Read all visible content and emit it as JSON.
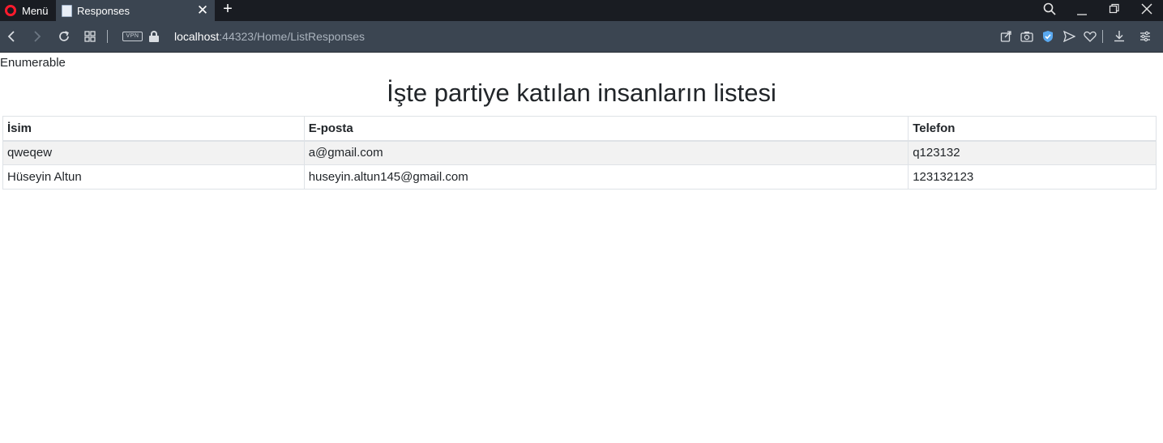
{
  "browser": {
    "menu_label": "Menü",
    "tab_title": "Responses",
    "url_host": "localhost",
    "url_path": ":44323/Home/ListResponses",
    "vpn_label": "VPN",
    "accent_color": "#ff1b2d"
  },
  "page": {
    "top_text": "Enumerable",
    "title": "İşte partiye katılan insanların listesi",
    "table": {
      "headers": [
        "İsim",
        "E-posta",
        "Telefon"
      ],
      "rows": [
        [
          "qweqew",
          "a@gmail.com",
          "q123132"
        ],
        [
          "Hüseyin Altun",
          "huseyin.altun145@gmail.com",
          "123132123"
        ]
      ]
    }
  }
}
